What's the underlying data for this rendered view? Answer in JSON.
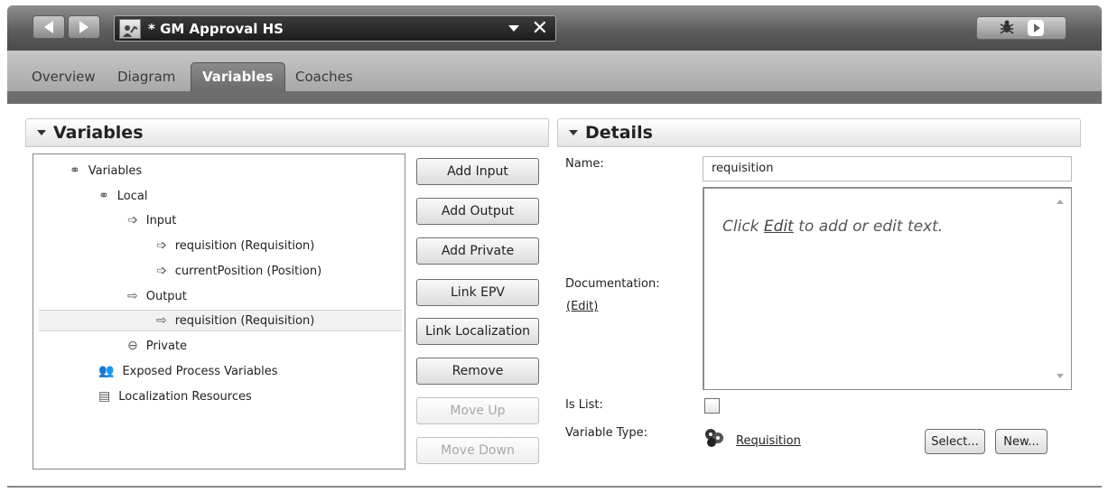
{
  "titlebar": {
    "document_title": "* GM Approval HS"
  },
  "tabs": [
    {
      "label": "Overview",
      "active": false
    },
    {
      "label": "Diagram",
      "active": false
    },
    {
      "label": "Variables",
      "active": true
    },
    {
      "label": "Coaches",
      "active": false
    }
  ],
  "variables_panel": {
    "header": "Variables",
    "tree": [
      {
        "label": "Variables",
        "icon": "variables-group-icon",
        "level": 0
      },
      {
        "label": "Local",
        "icon": "variables-group-icon",
        "level": 1
      },
      {
        "label": "Input",
        "icon": "input-arrow-icon",
        "level": 2
      },
      {
        "label": "requisition (Requisition)",
        "icon": "input-arrow-icon",
        "level": 3
      },
      {
        "label": "currentPosition (Position)",
        "icon": "input-arrow-icon",
        "level": 3
      },
      {
        "label": "Output",
        "icon": "output-arrow-icon",
        "level": 2
      },
      {
        "label": "requisition (Requisition)",
        "icon": "output-arrow-icon",
        "level": 3,
        "selected": true
      },
      {
        "label": "Private",
        "icon": "private-icon",
        "level": 2
      },
      {
        "label": "Exposed Process Variables",
        "icon": "exposed-vars-icon",
        "level": 1
      },
      {
        "label": "Localization Resources",
        "icon": "localization-icon",
        "level": 1
      }
    ],
    "buttons": {
      "add_input": "Add Input",
      "add_output": "Add Output",
      "add_private": "Add Private",
      "link_epv": "Link EPV",
      "link_localization": "Link Localization",
      "remove": "Remove",
      "move_up": "Move Up",
      "move_down": "Move Down"
    }
  },
  "details_panel": {
    "header": "Details",
    "name_label": "Name:",
    "name_value": "requisition",
    "documentation_label": "Documentation:",
    "edit_link": "(Edit)",
    "doc_placeholder_pre": "Click ",
    "doc_placeholder_link": "Edit",
    "doc_placeholder_post": " to add or edit text.",
    "is_list_label": "Is List:",
    "is_list_checked": false,
    "variable_type_label": "Variable Type:",
    "variable_type_value": "Requisition",
    "select_button": "Select...",
    "new_button": "New..."
  }
}
